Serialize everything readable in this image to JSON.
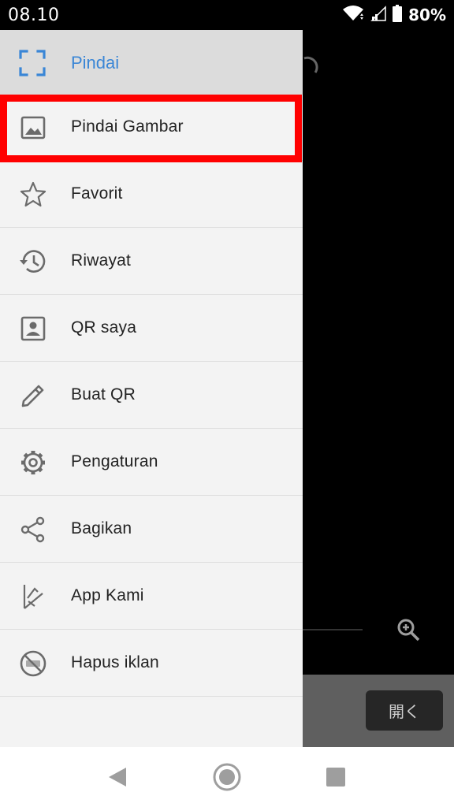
{
  "status_bar": {
    "time": "08.10",
    "battery_percent": "80%",
    "icons": [
      "wifi-icon",
      "signal-icon",
      "battery-icon"
    ]
  },
  "background": {
    "open_button_label": "開く",
    "icons": [
      "rotate-camera-icon",
      "zoom-in-icon"
    ]
  },
  "drawer": {
    "header": {
      "label": "Pindai",
      "icon": "scan-frame-icon",
      "color": "#3a86d6"
    },
    "items": [
      {
        "label": "Pindai Gambar",
        "icon": "image-icon"
      },
      {
        "label": "Favorit",
        "icon": "star-icon"
      },
      {
        "label": "Riwayat",
        "icon": "history-icon"
      },
      {
        "label": "QR saya",
        "icon": "contact-card-icon"
      },
      {
        "label": "Buat QR",
        "icon": "pencil-icon"
      },
      {
        "label": "Pengaturan",
        "icon": "gear-icon"
      },
      {
        "label": "Bagikan",
        "icon": "share-icon"
      },
      {
        "label": "App Kami",
        "icon": "app-kami-icon"
      },
      {
        "label": "Hapus iklan",
        "icon": "no-ads-icon"
      }
    ],
    "highlighted_item": "Pindai Gambar",
    "highlight_color": "#ff0000"
  },
  "nav_bar": {
    "icons": [
      "back-icon",
      "home-icon",
      "recents-icon"
    ]
  }
}
